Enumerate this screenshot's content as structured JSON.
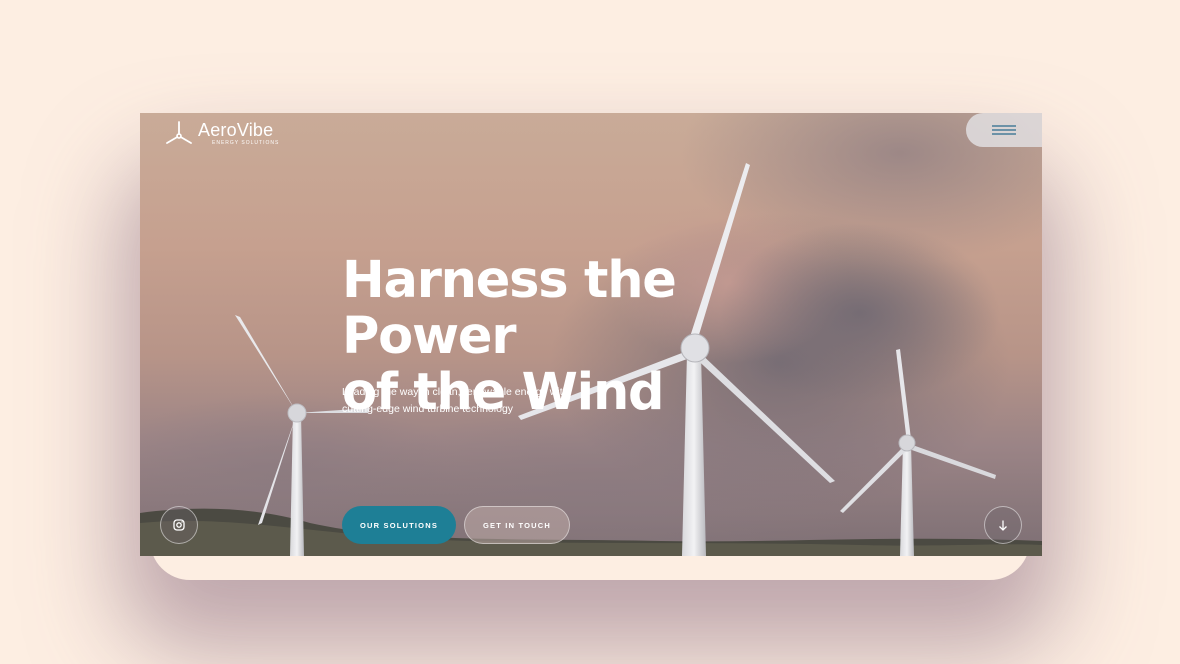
{
  "brand": {
    "name": "AeroVibe",
    "tagline": "ENERGY SOLUTIONS",
    "logo_icon": "wind-turbine-logo-icon"
  },
  "nav": {
    "menu_icon": "hamburger-menu-icon"
  },
  "hero": {
    "title_line1": "Harness the Power",
    "title_line2": "of the Wind",
    "subtitle_line1": "Leading the way in clean, renewable energy with",
    "subtitle_line2": "cutting-edge wind turbine technology"
  },
  "buttons": {
    "primary_label": "OUR SOLUTIONS",
    "secondary_label": "GET IN TOUCH"
  },
  "social": {
    "instagram_icon": "instagram-icon"
  },
  "scroll": {
    "icon": "arrow-down-icon"
  },
  "colors": {
    "page_background": "#fdeee2",
    "accent": "#1e7f96",
    "menu_lines": "#2b6a8c"
  }
}
